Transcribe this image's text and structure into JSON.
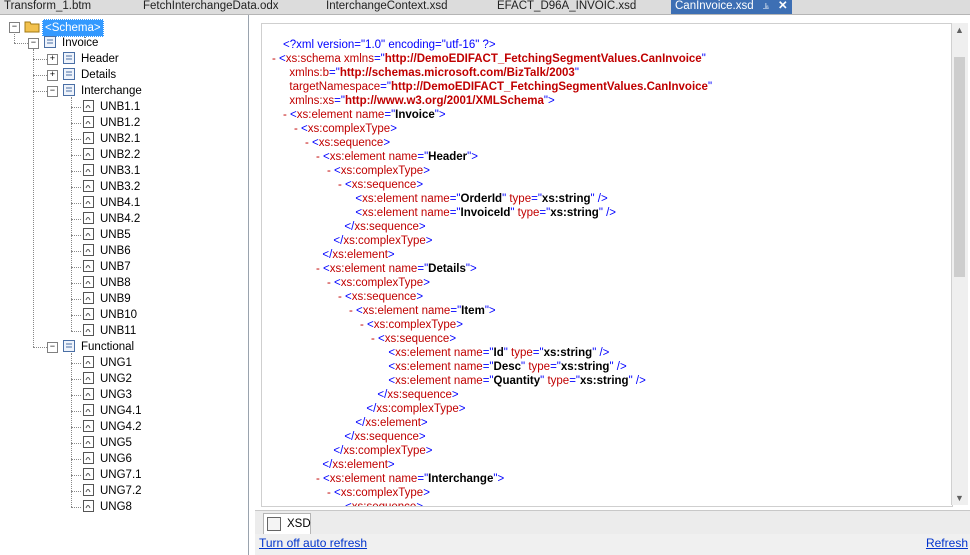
{
  "tabs": [
    {
      "label": "Transform_1.btm"
    },
    {
      "label": "FetchInterchangeData.odx"
    },
    {
      "label": "InterchangeContext.xsd"
    },
    {
      "label": "EFACT_D96A_INVOIC.xsd"
    },
    {
      "label": "CanInvoice.xsd",
      "active": true
    }
  ],
  "tree": {
    "root": "<Schema>",
    "invoice": "Invoice",
    "header": "Header",
    "details": "Details",
    "interchange": "Interchange",
    "interchange_children": [
      "UNB1.1",
      "UNB1.2",
      "UNB2.1",
      "UNB2.2",
      "UNB3.1",
      "UNB3.2",
      "UNB4.1",
      "UNB4.2",
      "UNB5",
      "UNB6",
      "UNB7",
      "UNB8",
      "UNB9",
      "UNB10",
      "UNB11"
    ],
    "functional": "Functional",
    "functional_children": [
      "UNG1",
      "UNG2",
      "UNG3",
      "UNG4.1",
      "UNG4.2",
      "UNG5",
      "UNG6",
      "UNG7.1",
      "UNG7.2",
      "UNG8"
    ]
  },
  "xml": {
    "decl": "<?xml version=\"1.0\" encoding=\"utf-16\" ?>",
    "lines": [
      {
        "m": "-",
        "i": 0,
        "t": "<xs:schema xmlns=\"http://DemoEDIFACT_FetchingSegmentValues.CanInvoice\""
      },
      {
        "m": "",
        "i": 1,
        "t": "xmlns:b=\"http://schemas.microsoft.com/BizTalk/2003\""
      },
      {
        "m": "",
        "i": 1,
        "t": "targetNamespace=\"http://DemoEDIFACT_FetchingSegmentValues.CanInvoice\""
      },
      {
        "m": "",
        "i": 1,
        "t": "xmlns:xs=\"http://www.w3.org/2001/XMLSchema\">"
      },
      {
        "m": "-",
        "i": 1,
        "t": "<xs:element name=\"Invoice\">"
      },
      {
        "m": "-",
        "i": 2,
        "t": "<xs:complexType>"
      },
      {
        "m": "-",
        "i": 3,
        "t": "<xs:sequence>"
      },
      {
        "m": "-",
        "i": 4,
        "t": "<xs:element name=\"Header\">"
      },
      {
        "m": "-",
        "i": 5,
        "t": "<xs:complexType>"
      },
      {
        "m": "-",
        "i": 6,
        "t": "<xs:sequence>"
      },
      {
        "m": "",
        "i": 7,
        "t": "<xs:element name=\"OrderId\" type=\"xs:string\" />"
      },
      {
        "m": "",
        "i": 7,
        "t": "<xs:element name=\"InvoiceId\" type=\"xs:string\" />"
      },
      {
        "m": "",
        "i": 6,
        "t": "</xs:sequence>"
      },
      {
        "m": "",
        "i": 5,
        "t": "</xs:complexType>"
      },
      {
        "m": "",
        "i": 4,
        "t": "</xs:element>"
      },
      {
        "m": "-",
        "i": 4,
        "t": "<xs:element name=\"Details\">"
      },
      {
        "m": "-",
        "i": 5,
        "t": "<xs:complexType>"
      },
      {
        "m": "-",
        "i": 6,
        "t": "<xs:sequence>"
      },
      {
        "m": "-",
        "i": 7,
        "t": "<xs:element name=\"Item\">"
      },
      {
        "m": "-",
        "i": 8,
        "t": "<xs:complexType>"
      },
      {
        "m": "-",
        "i": 9,
        "t": "<xs:sequence>"
      },
      {
        "m": "",
        "i": 10,
        "t": "<xs:element name=\"Id\" type=\"xs:string\" />"
      },
      {
        "m": "",
        "i": 10,
        "t": "<xs:element name=\"Desc\" type=\"xs:string\" />"
      },
      {
        "m": "",
        "i": 10,
        "t": "<xs:element name=\"Quantity\" type=\"xs:string\" />"
      },
      {
        "m": "",
        "i": 9,
        "t": "</xs:sequence>"
      },
      {
        "m": "",
        "i": 8,
        "t": "</xs:complexType>"
      },
      {
        "m": "",
        "i": 7,
        "t": "</xs:element>"
      },
      {
        "m": "",
        "i": 6,
        "t": "</xs:sequence>"
      },
      {
        "m": "",
        "i": 5,
        "t": "</xs:complexType>"
      },
      {
        "m": "",
        "i": 4,
        "t": "</xs:element>"
      },
      {
        "m": "-",
        "i": 4,
        "t": "<xs:element name=\"Interchange\">"
      },
      {
        "m": "-",
        "i": 5,
        "t": "<xs:complexType>"
      },
      {
        "m": "-",
        "i": 6,
        "t": "<xs:sequence>"
      }
    ]
  },
  "bottom": {
    "view_tab": "XSD",
    "auto_refresh_link": "Turn off auto refresh",
    "refresh_link": "Refresh"
  },
  "colors": {
    "markup": "#0000ff",
    "attr_name": "#c00000",
    "selection": "#3399ff",
    "active_tab": "#3d6fb4"
  }
}
